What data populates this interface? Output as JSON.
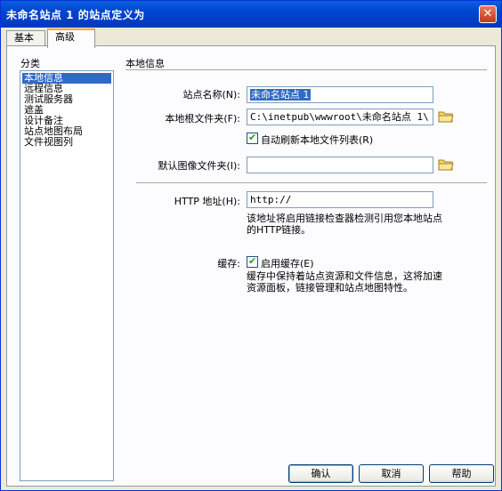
{
  "window": {
    "title": "未命名站点 1 的站点定义为",
    "close_symbol": "✕"
  },
  "tabs": [
    {
      "label": "基本"
    },
    {
      "label": "高级"
    }
  ],
  "category": {
    "label": "分类",
    "items": [
      "本地信息",
      "远程信息",
      "测试服务器",
      "遮盖",
      "设计备注",
      "站点地图布局",
      "文件视图列"
    ],
    "selected": "本地信息"
  },
  "local_info": {
    "section_title": "本地信息",
    "site_name_label": "站点名称(N):",
    "site_name_value": "未命名站点 1",
    "root_folder_label": "本地根文件夹(F):",
    "root_folder_value": "C:\\inetpub\\wwwroot\\未命名站点 1\\",
    "auto_refresh_label": "自动刷新本地文件列表(R)",
    "auto_refresh_checked": true,
    "default_images_label": "默认图像文件夹(I):",
    "default_images_value": "",
    "http_label": "HTTP 地址(H):",
    "http_value": "http://",
    "http_note": "该地址将启用链接检查器检测引用您本地站点的HTTP链接。",
    "cache_label": "缓存:",
    "cache_checkbox_label": "启用缓存(E)",
    "cache_checked": true,
    "cache_note": "缓存中保持着站点资源和文件信息，这将加速资源面板，链接管理和站点地图特性。"
  },
  "buttons": {
    "ok": "确认",
    "cancel": "取消",
    "help": "帮助"
  },
  "colors": {
    "titlebar": "#0044d0",
    "selection": "#316ac5",
    "dialog_bg": "#ECE9D8"
  }
}
